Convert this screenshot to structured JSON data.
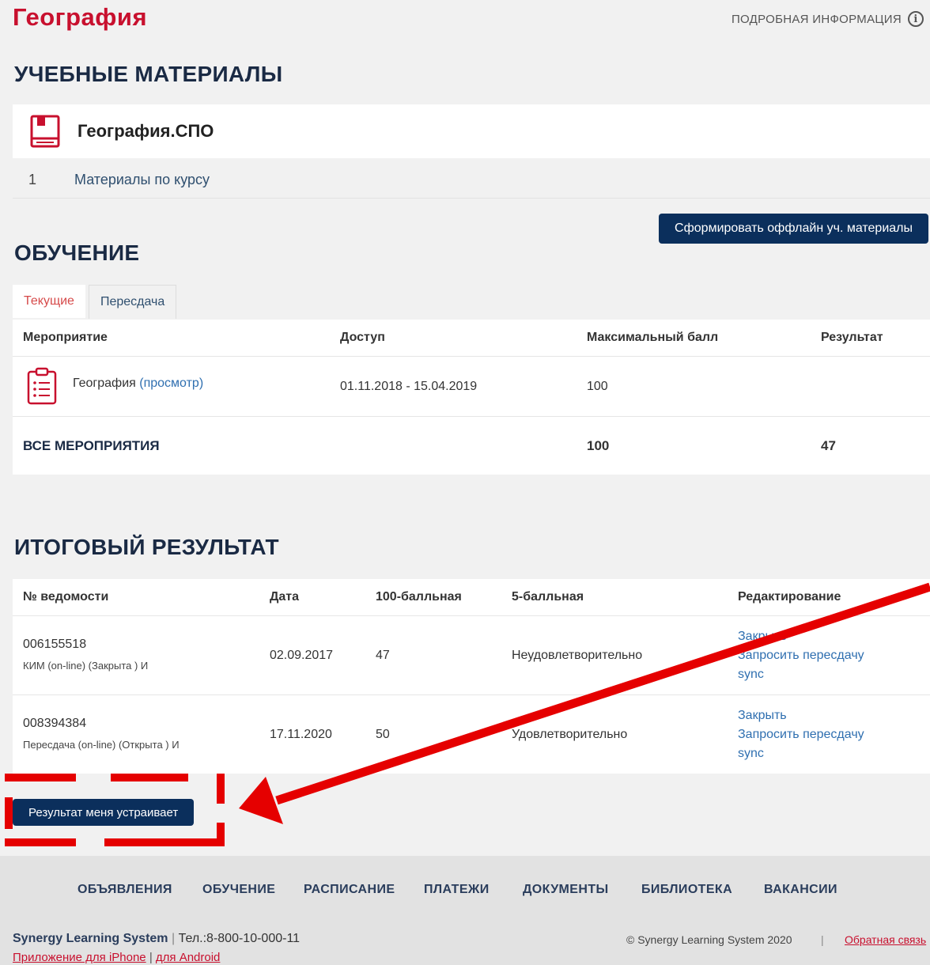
{
  "page": {
    "title": "География",
    "details_link": "ПОДРОБНАЯ ИНФОРМАЦИЯ",
    "info_icon": "i"
  },
  "materials": {
    "heading": "УЧЕБНЫЕ МАТЕРИАЛЫ",
    "course_name": "География.СПО",
    "items": [
      {
        "index": "1",
        "label": "Материалы по курсу"
      }
    ],
    "offline_button": "Сформировать оффлайн уч. материалы"
  },
  "learning": {
    "heading": "ОБУЧЕНИЕ",
    "tabs": [
      {
        "label": "Текущие",
        "active": true
      },
      {
        "label": "Пересдача",
        "active": false
      }
    ],
    "columns": [
      "Мероприятие",
      "Доступ",
      "Максимальный балл",
      "Результат"
    ],
    "rows": [
      {
        "name": "География",
        "view_link": "(просмотр)",
        "access": "01.11.2018 - 15.04.2019",
        "max_score": "100",
        "result": ""
      }
    ],
    "total": {
      "label": "ВСЕ МЕРОПРИЯТИЯ",
      "max_score": "100",
      "result": "47"
    }
  },
  "final": {
    "heading": "ИТОГОВЫЙ РЕЗУЛЬТАТ",
    "columns": [
      "№ ведомости",
      "Дата",
      "100-балльная",
      "5-балльная",
      "Редактирование"
    ],
    "rows": [
      {
        "number": "006155518",
        "desc": "КИМ (on-line) (Закрыта ) И",
        "date": "02.09.2017",
        "score100": "47",
        "score5": "Неудовлетворительно",
        "actions": [
          "Закрыть",
          "Запросить пересдачу",
          "sync"
        ]
      },
      {
        "number": "008394384",
        "desc": "Пересдача (on-line) (Открыта ) И",
        "date": "17.11.2020",
        "score100": "50",
        "score5": "Удовлетворительно",
        "actions": [
          "Закрыть",
          "Запросить пересдачу",
          "sync"
        ]
      }
    ],
    "accept_button": "Результат меня устраивает"
  },
  "footer": {
    "nav": [
      "ОБЪЯВЛЕНИЯ",
      "ОБУЧЕНИЕ",
      "РАСПИСАНИЕ",
      "ПЛАТЕЖИ",
      "ДОКУМЕНТЫ",
      "БИБЛИОТЕКА",
      "ВАКАНСИИ"
    ],
    "brand": "Synergy Learning System",
    "phone": "Тел.:8-800-10-000-11",
    "app_iphone": "Приложение для iPhone",
    "app_android": "для Android",
    "copyright": "© Synergy Learning System 2020",
    "feedback": "Обратная связь"
  },
  "colors": {
    "accent": "#c8102e",
    "primary_button": "#0b2f5c",
    "annotation": "#e50000"
  },
  "icons": {
    "course": "book-icon",
    "event": "clipboard-icon",
    "info": "info-icon"
  }
}
